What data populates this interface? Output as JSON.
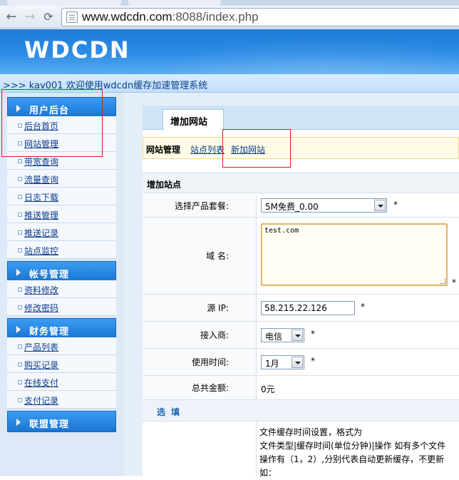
{
  "browser": {
    "back_glyph": "←",
    "forward_glyph": "→",
    "url_host": "www.wdcdn.com",
    "url_rest": ":8088/index.php"
  },
  "site": {
    "logo": "WDCDN",
    "welcome": ">>> kav001 欢迎使用wdcdn缓存加速管理系统"
  },
  "sidebar": {
    "sections": [
      {
        "title": "用户后台",
        "items": [
          "后台首页",
          "网站管理",
          "带宽查询",
          "流量查询",
          "日志下载",
          "推送管理",
          "推送记录",
          "站点监控"
        ]
      },
      {
        "title": "帐号管理",
        "items": [
          "资料修改",
          "修改密码"
        ]
      },
      {
        "title": "财务管理",
        "items": [
          "产品列表",
          "购买记录",
          "在线支付",
          "支付记录"
        ]
      },
      {
        "title": "联盟管理",
        "items": []
      }
    ]
  },
  "main": {
    "tab_label": "增加网站",
    "breadcrumb": {
      "title": "网站管理",
      "link_list": "站点列表",
      "link_add": "新加网站"
    },
    "form": {
      "section_title": "增加站点",
      "package_label": "选择产品套餐:",
      "package_value": "5M免费_0.00",
      "domain_label": "域 名:",
      "domain_value": "test.com",
      "source_ip_label": "源 IP:",
      "source_ip_value": "58.215.22.126",
      "isp_label": "接入商:",
      "isp_value": "电信",
      "duration_label": "使用时间:",
      "duration_value": "1月",
      "total_label": "总共金额:",
      "total_value": "0元",
      "required_mark": "*",
      "optional_title": "选 填",
      "cache_desc_1": "文件缓存时间设置，格式为",
      "cache_desc_2": "文件类型|缓存时间(单位分钟)|操作 如有多个文件",
      "cache_desc_3": "操作有（1，2）,分别代表自动更新缓存，不更新",
      "cache_desc_4": "如："
    }
  },
  "colors": {
    "header_blue": "#1d7ad8",
    "sidebar_head": "#2a86e4",
    "link_blue": "#0b3a8c",
    "annotation_red": "#cc2222"
  }
}
